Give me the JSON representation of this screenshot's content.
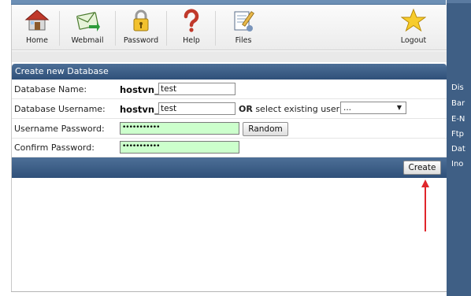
{
  "toolbar": {
    "items": [
      {
        "label": "Home",
        "icon": "home-icon"
      },
      {
        "label": "Webmail",
        "icon": "mail-icon"
      },
      {
        "label": "Password",
        "icon": "lock-icon"
      },
      {
        "label": "Help",
        "icon": "question-icon"
      },
      {
        "label": "Files",
        "icon": "files-icon"
      },
      {
        "label": "Logout",
        "icon": "star-icon"
      }
    ]
  },
  "section": {
    "title": "Create new Database"
  },
  "form": {
    "db_name_label": "Database Name:",
    "db_name_prefix": "hostvn_",
    "db_name_value": "test",
    "db_user_label": "Database Username:",
    "db_user_prefix": "hostvn_",
    "db_user_value": "test",
    "or_word": "OR",
    "select_existing_label": "select existing user",
    "existing_user_selected": "...",
    "password_label": "Username Password:",
    "password_value": "•••••••••••",
    "random_button": "Random",
    "confirm_label": "Confirm Password:",
    "confirm_value": "•••••••••••",
    "create_button": "Create"
  },
  "right_sidebar": {
    "items": [
      "Dis",
      "Bar",
      "E-N",
      "Ftp",
      "Dat",
      "Ino"
    ]
  },
  "colors": {
    "header_blue": "#2f5079",
    "password_bg": "#ccffcc",
    "annotation_arrow": "#e0262b"
  }
}
